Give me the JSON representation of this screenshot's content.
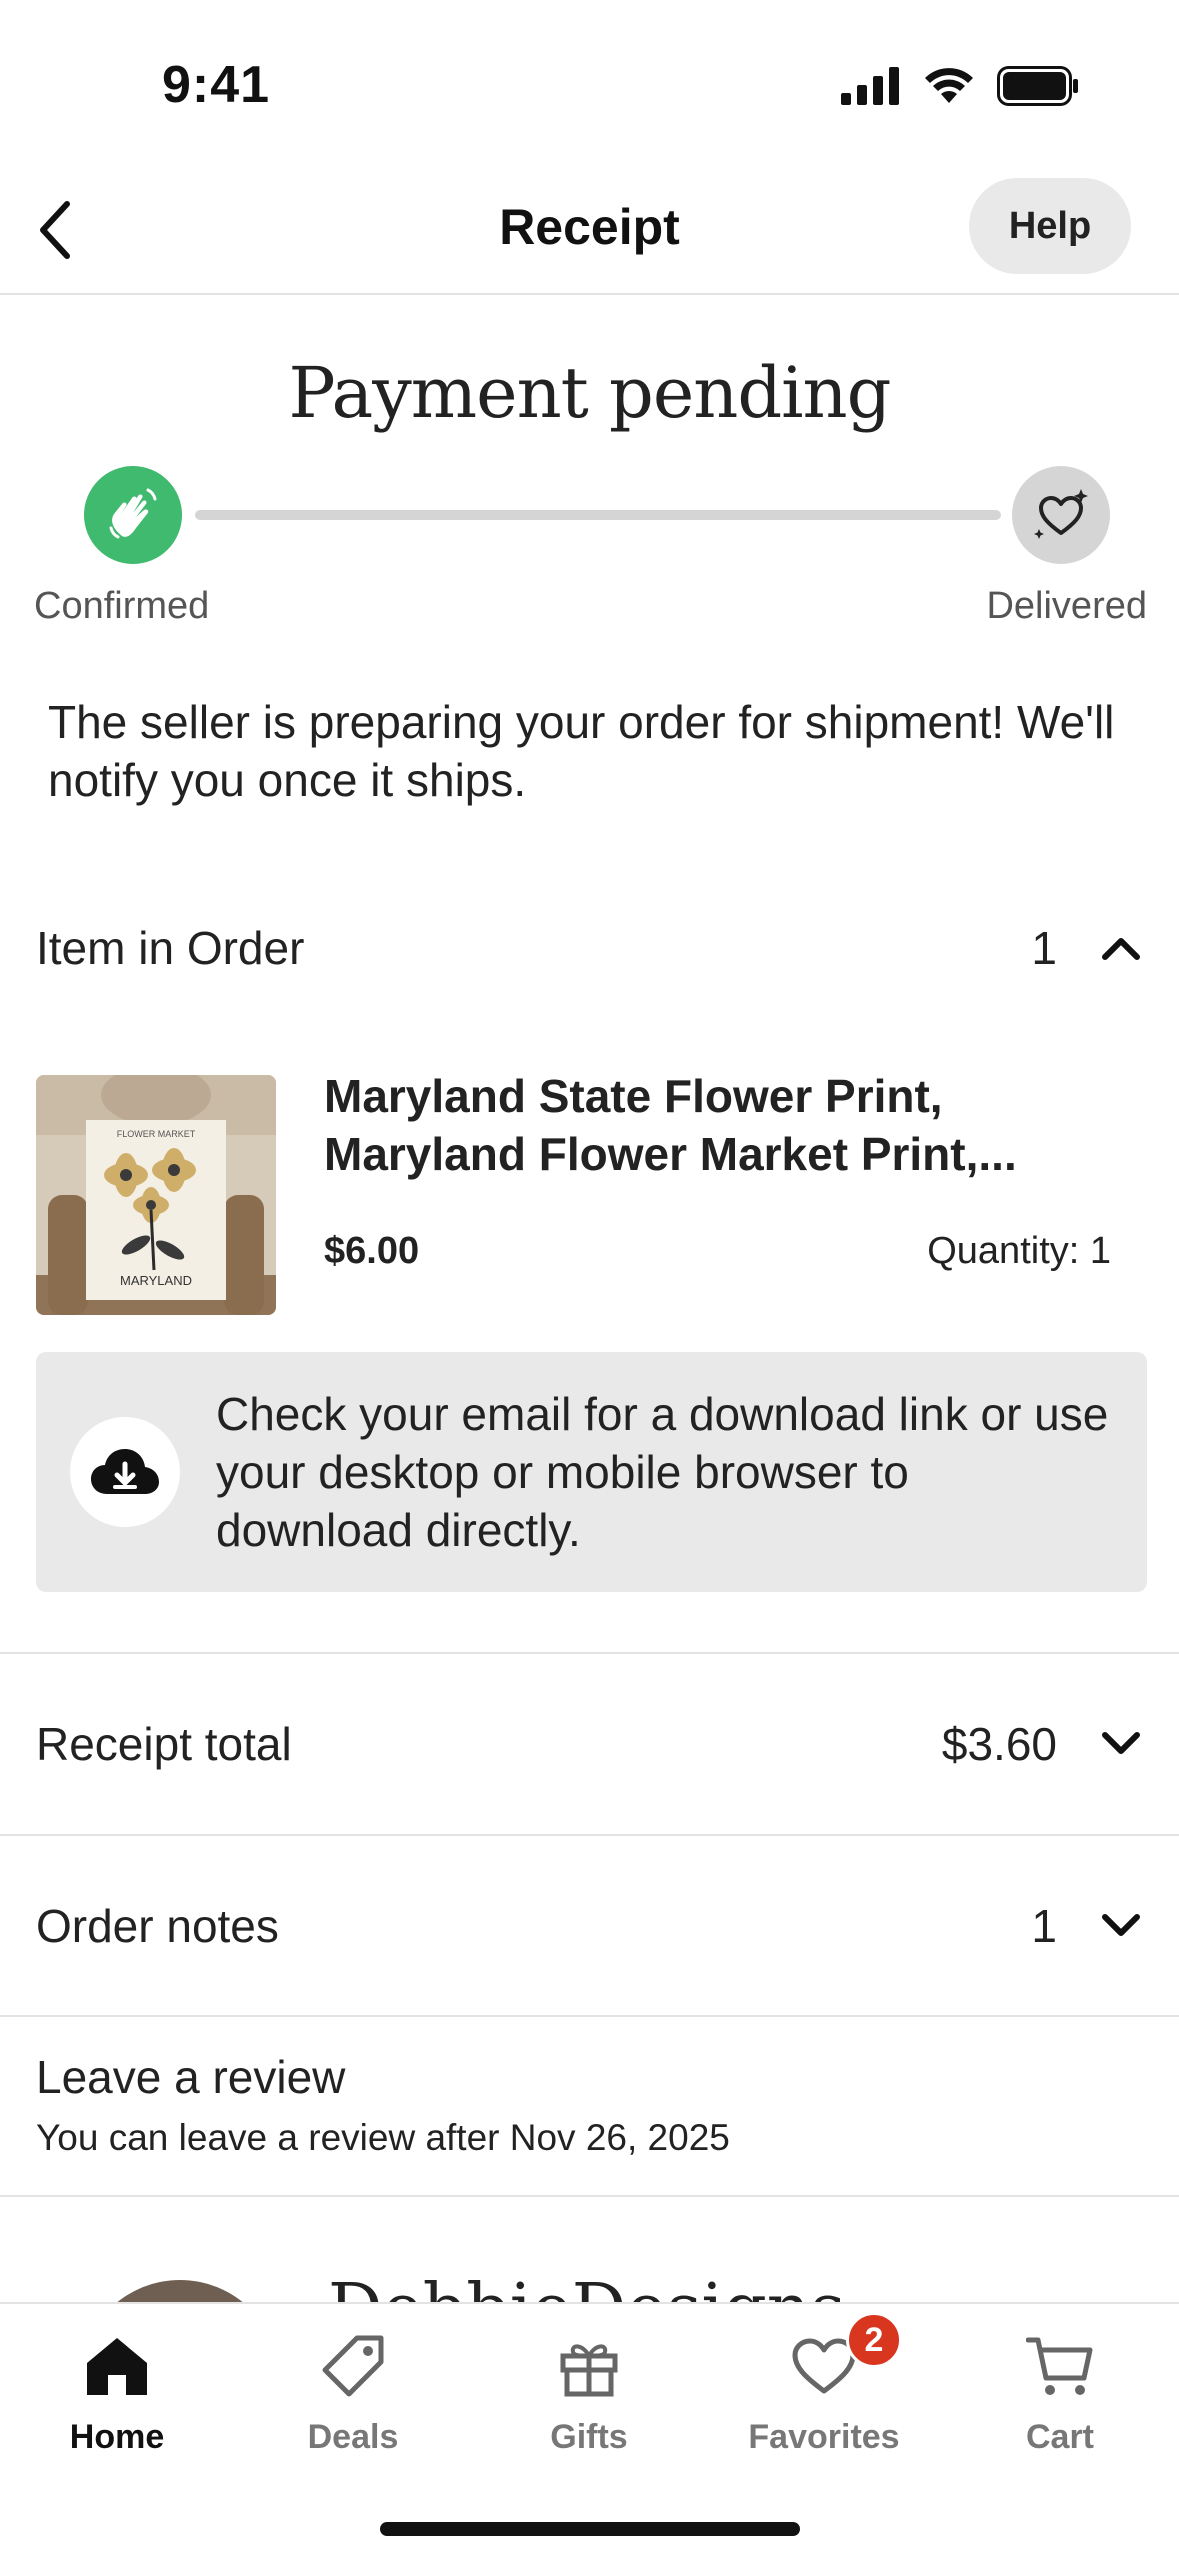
{
  "status_bar": {
    "time": "9:41"
  },
  "header": {
    "title": "Receipt",
    "help_label": "Help",
    "back_icon": "chevron-left-icon"
  },
  "status": {
    "heading": "Payment pending",
    "steps": [
      {
        "label": "Confirmed",
        "icon": "waving-hand-icon",
        "color": "#3fba6e"
      },
      {
        "label": "Delivered",
        "icon": "heart-sparkle-icon",
        "color": "#d5d5d5"
      }
    ],
    "message": "The seller is preparing your order for shipment! We'll notify you once it ships."
  },
  "items_section": {
    "label": "Item in Order",
    "count": "1",
    "item": {
      "title": "Maryland State Flower Print, Maryland Flower Market Print,...",
      "price": "$6.00",
      "quantity": "Quantity: 1",
      "thumb_text_top": "FLOWER MARKET",
      "thumb_text_bottom": "MARYLAND"
    },
    "download_notice": "Check your email for a download link or use your desktop or mobile browser to download directly."
  },
  "receipt_total": {
    "label": "Receipt total",
    "value": "$3.60"
  },
  "order_notes": {
    "label": "Order notes",
    "count": "1"
  },
  "review": {
    "title": "Leave a review",
    "subtitle": "You can leave a review after Nov 26, 2025"
  },
  "shop": {
    "name": "DebbieDesigns"
  },
  "tab_bar": {
    "tabs": [
      {
        "label": "Home",
        "icon": "home-icon",
        "active": true
      },
      {
        "label": "Deals",
        "icon": "tag-icon"
      },
      {
        "label": "Gifts",
        "icon": "gift-icon"
      },
      {
        "label": "Favorites",
        "icon": "heart-icon",
        "badge": "2"
      },
      {
        "label": "Cart",
        "icon": "cart-icon"
      }
    ]
  }
}
